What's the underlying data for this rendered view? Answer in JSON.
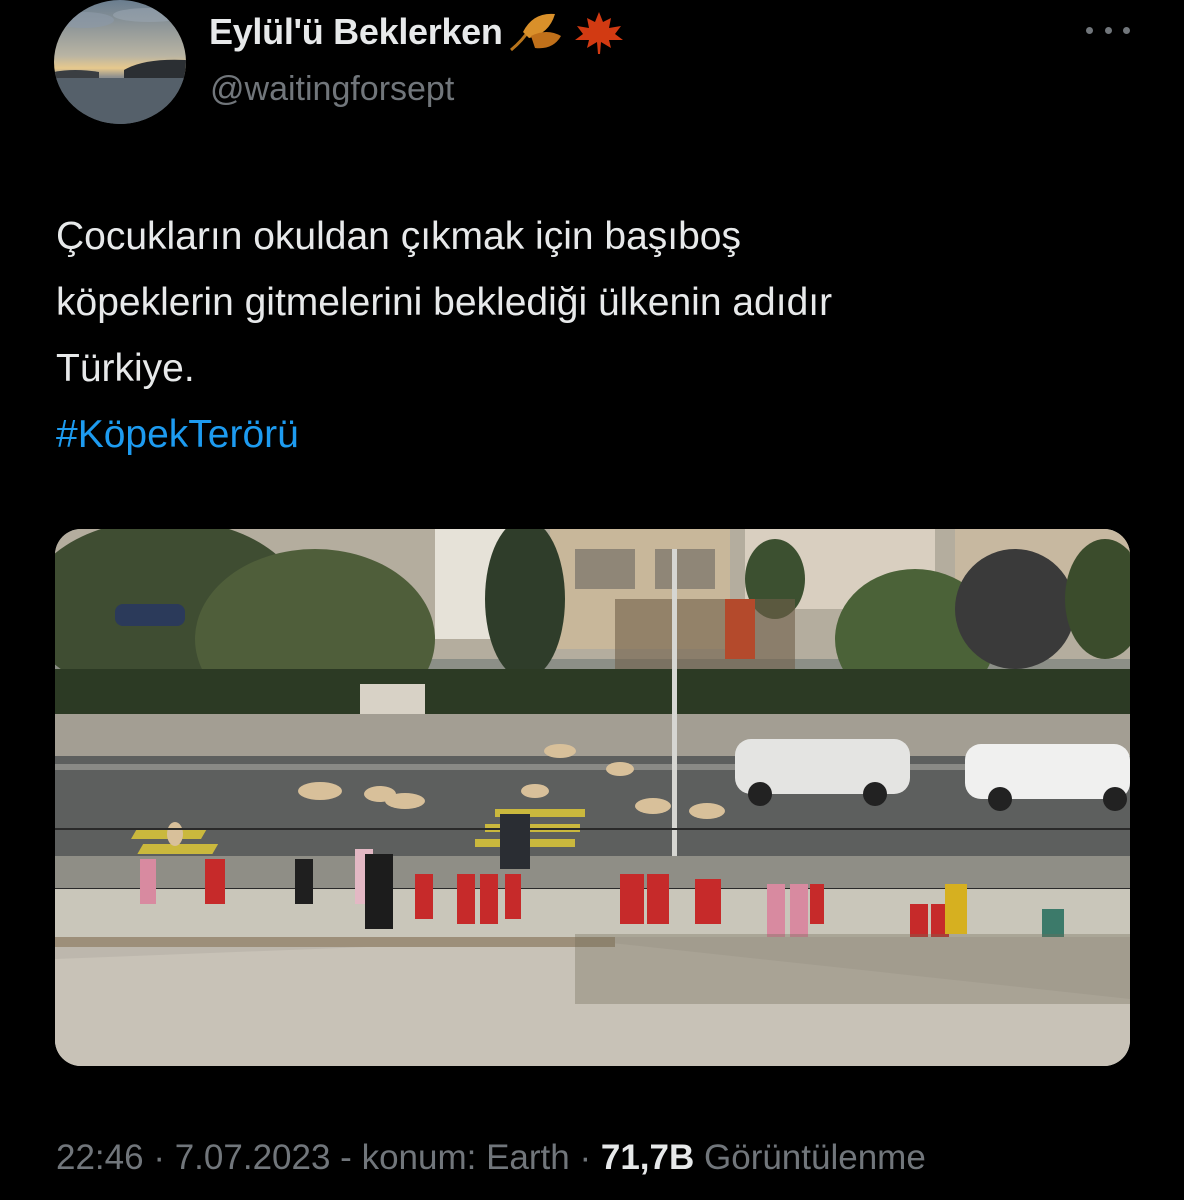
{
  "header": {
    "display_name": "Eylül'ü Beklerken",
    "handle": "@waitingforsept",
    "emojis": [
      "fallen-leaf",
      "maple-leaf"
    ]
  },
  "tweet": {
    "lines": [
      "Çocukların okuldan çıkmak için başıboş",
      "köpeklerin gitmelerini beklediği ülkenin adıdır",
      "Türkiye."
    ],
    "hashtag": "#KöpekTerörü"
  },
  "media": {
    "description_icon": "photo-icon",
    "sign_text": ""
  },
  "meta": {
    "time": "22:46",
    "date": "7.07.2023",
    "location_prefix": "konum:",
    "location": "Earth",
    "views_count": "71,7B",
    "views_label": "Görüntülenme"
  },
  "colors": {
    "background": "#000000",
    "text": "#e7e9ea",
    "muted": "#71767b",
    "link": "#1d9bf0"
  }
}
